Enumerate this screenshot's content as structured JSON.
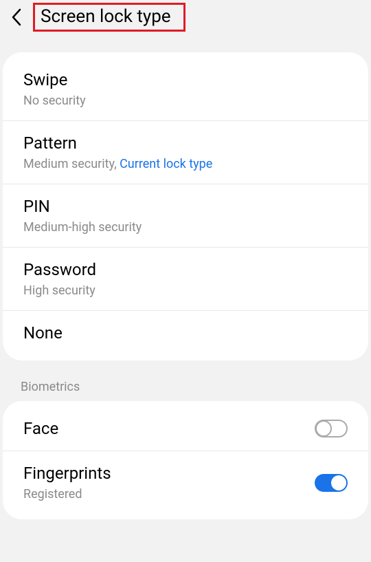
{
  "header": {
    "title": "Screen lock type"
  },
  "lockTypes": {
    "swipe": {
      "label": "Swipe",
      "sub": "No security"
    },
    "pattern": {
      "label": "Pattern",
      "sub": "Medium security, ",
      "current": "Current lock type"
    },
    "pin": {
      "label": "PIN",
      "sub": "Medium-high security"
    },
    "password": {
      "label": "Password",
      "sub": "High security"
    },
    "none": {
      "label": "None"
    }
  },
  "biometrics": {
    "header": "Biometrics",
    "face": {
      "label": "Face",
      "enabled": false
    },
    "fingerprints": {
      "label": "Fingerprints",
      "sub": "Registered",
      "enabled": true
    }
  }
}
